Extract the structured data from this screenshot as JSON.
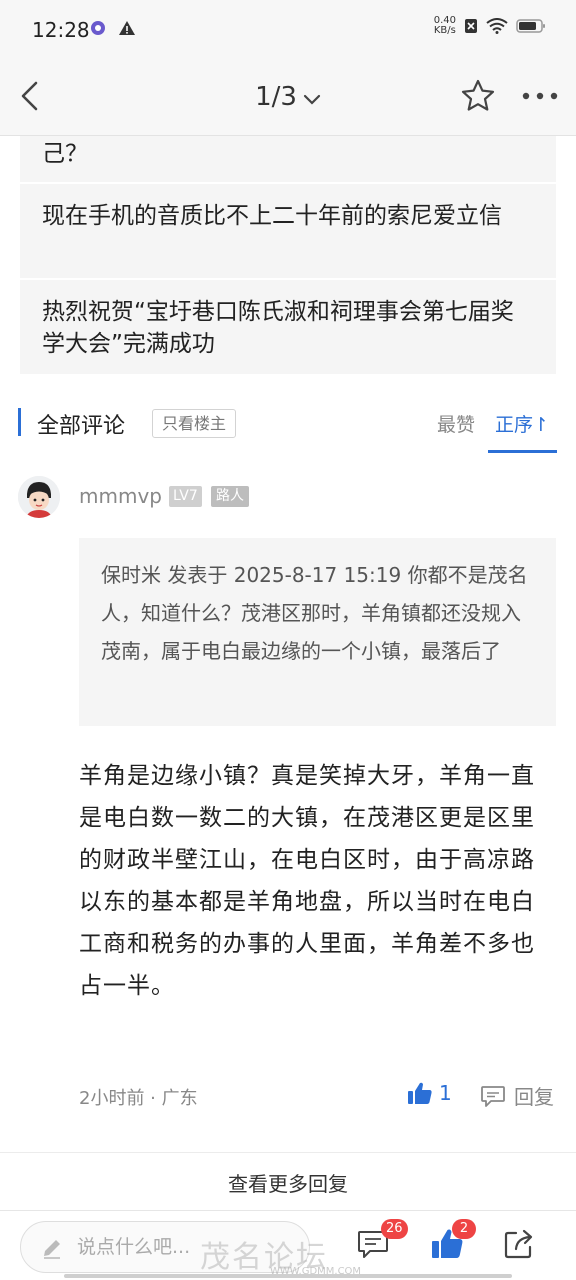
{
  "status_bar": {
    "time": "12:28",
    "net_speed_value": "0.40",
    "net_speed_unit": "KB/s"
  },
  "nav": {
    "page_indicator": "1/3"
  },
  "related": {
    "items": [
      "己？",
      "现在手机的音质比不上二十年前的索尼爱立信",
      "热烈祝贺“宝圩巷口陈氏淑和祠理事会第七届奖学大会”完满成功"
    ]
  },
  "comments": {
    "title": "全部评论",
    "owner_only": "只看楼主",
    "sort_hot": "最赞",
    "sort_order": "正序↾"
  },
  "comment": {
    "username": "mmmvp",
    "level": "LV7",
    "role": "路人",
    "quote": "保时米 发表于 2025-8-17 15:19 你都不是茂名人，知道什么？茂港区那时，羊角镇都还没规入茂南，属于电白最边缘的一个小镇，最落后了",
    "body": "羊角是边缘小镇？真是笑掉大牙，羊角一直是电白数一数二的大镇，在茂港区更是区里的财政半壁江山，在电白区时，由于高凉路以东的基本都是羊角地盘，所以当时在电白工商和税务的办事的人里面，羊角差不多也占一半。",
    "meta": "2小时前 · 广东",
    "like_count": "1",
    "reply_label": "回复"
  },
  "more_replies": "查看更多回复",
  "bottom_bar": {
    "input_placeholder": "说点什么吧...",
    "comment_badge": "26",
    "like_badge": "2"
  },
  "watermark": {
    "text": "茂名论坛",
    "url": "WWW.GDMM.COM"
  },
  "colors": {
    "accent": "#2b6fd6",
    "badge_red": "#ee4444"
  }
}
